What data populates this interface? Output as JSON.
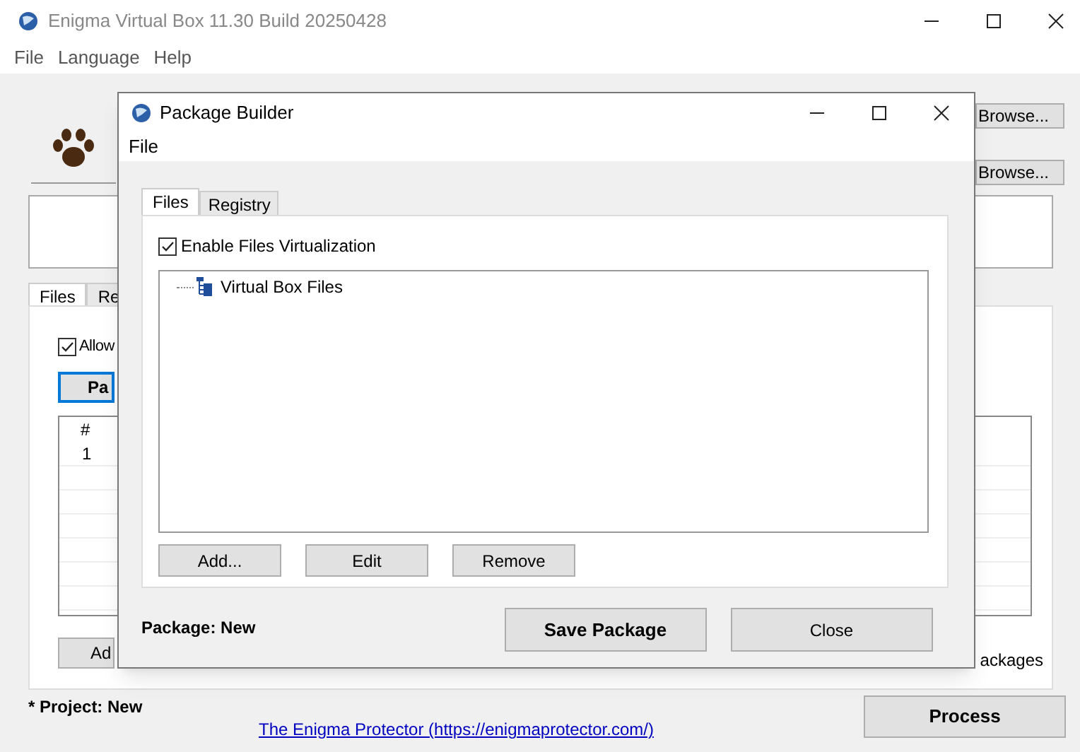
{
  "window": {
    "title": "Enigma Virtual Box 11.30 Build 20250428"
  },
  "menu": [
    "File",
    "Language",
    "Help"
  ],
  "main": {
    "browse_buttons": [
      "Browse...",
      "Browse..."
    ],
    "tabs": [
      {
        "label": "Files",
        "selected": true
      },
      {
        "label": "Re",
        "selected": false
      }
    ],
    "allow": {
      "label": "Allow",
      "checked": true
    },
    "package_button": "Pa",
    "table": {
      "columns": [
        "#"
      ],
      "rows": [
        [
          "1"
        ]
      ]
    },
    "add_button": "Ad",
    "packages_label": "ackages"
  },
  "project_status": "* Project: New",
  "link": "The Enigma Protector (https://enigmaprotector.com/)",
  "process_button": "Process",
  "dialog": {
    "title": "Package Builder",
    "menu": [
      "File"
    ],
    "tabs": [
      {
        "label": "Files",
        "selected": true
      },
      {
        "label": "Registry",
        "selected": false
      }
    ],
    "virtualization": {
      "label": "Enable Files Virtualization",
      "checked": true
    },
    "tree": [
      {
        "label": "Virtual Box Files"
      }
    ],
    "buttons": [
      "Add...",
      "Edit",
      "Remove"
    ],
    "package_status": "Package: New",
    "save_button": "Save Package",
    "close_button": "Close"
  }
}
